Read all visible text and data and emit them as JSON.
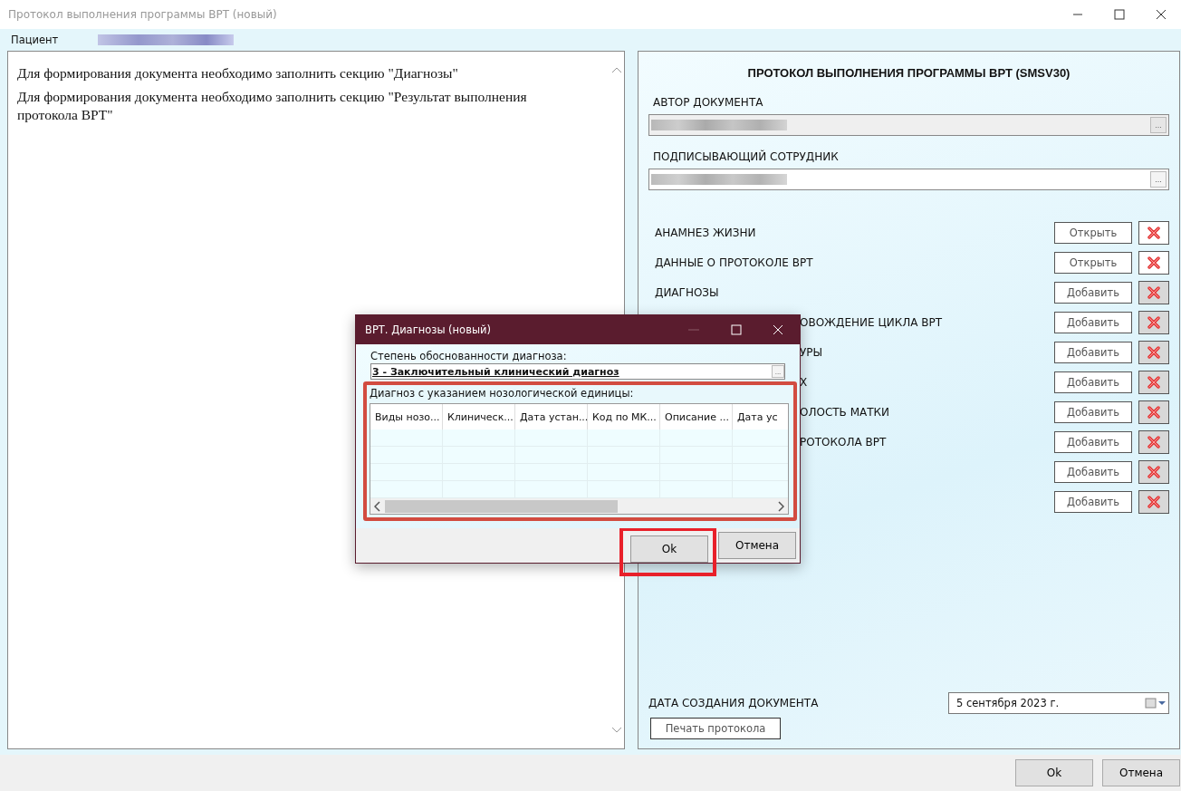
{
  "window": {
    "title": "Протокол выполнения программы ВРТ (новый)"
  },
  "patient": {
    "label": "Пациент"
  },
  "messages": [
    "Для формирования документа необходимо заполнить секцию \"Диагнозы\"",
    "Для формирования документа необходимо заполнить секцию \"Результат выполнения протокола ВРТ\""
  ],
  "form": {
    "title": "ПРОТОКОЛ ВЫПОЛНЕНИЯ ПРОГРАММЫ ВРТ (SMSV30)",
    "fields": [
      {
        "label": "АВТОР ДОКУМЕНТА",
        "disabled": true,
        "button": "..."
      },
      {
        "label": "ПОДПИСЫВАЮЩИЙ СОТРУДНИК",
        "disabled": false,
        "button": "..."
      }
    ],
    "sections": [
      {
        "label": "АНАМНЕЗ ЖИЗНИ",
        "kind": "full",
        "action": "Открыть",
        "delete_disabled": false
      },
      {
        "label": "ДАННЫЕ О ПРОТОКОЛЕ ВРТ",
        "kind": "full",
        "action": "Открыть",
        "delete_disabled": false
      },
      {
        "label": "ДИАГНОЗЫ",
        "kind": "full",
        "action": "Добавить",
        "delete_disabled": true
      },
      {
        "label": "ОВОЖДЕНИЕ ЦИКЛА ВРТ",
        "kind": "cut",
        "action": "Добавить",
        "delete_disabled": true
      },
      {
        "label": "УРЫ",
        "kind": "cut",
        "action": "Добавить",
        "delete_disabled": true
      },
      {
        "label": "Х",
        "kind": "cut",
        "action": "Добавить",
        "delete_disabled": true
      },
      {
        "label": "ОЛОСТЬ МАТКИ",
        "kind": "cut",
        "action": "Добавить",
        "delete_disabled": true
      },
      {
        "label": "РОТОКОЛА ВРТ",
        "kind": "cut",
        "action": "Добавить",
        "delete_disabled": true
      },
      {
        "kind": "hidden",
        "action": "Добавить",
        "delete_disabled": true
      },
      {
        "kind": "hidden",
        "action": "Добавить",
        "delete_disabled": true
      }
    ],
    "date_label": "ДАТА СОЗДАНИЯ ДОКУМЕНТА",
    "date_value": "5 сентября 2023 г.",
    "print_button": "Печать протокола"
  },
  "buttons": [
    "Ok",
    "Отмена"
  ],
  "dialog": {
    "title": "ВРТ. Диагнозы (новый)",
    "degree_label": "Степень обоснованности диагноза:",
    "degree_value": "3 - Заключительный клинический диагноз",
    "degree_button": "...",
    "grid_label": "Диагноз с указанием нозологической единицы:",
    "columns": [
      "Виды нозо...",
      "Клиническ...",
      "Дата устан...",
      "Код по МК...",
      "Описание ...",
      "Дата ус"
    ],
    "buttons": [
      "Ok",
      "Отмена"
    ]
  }
}
